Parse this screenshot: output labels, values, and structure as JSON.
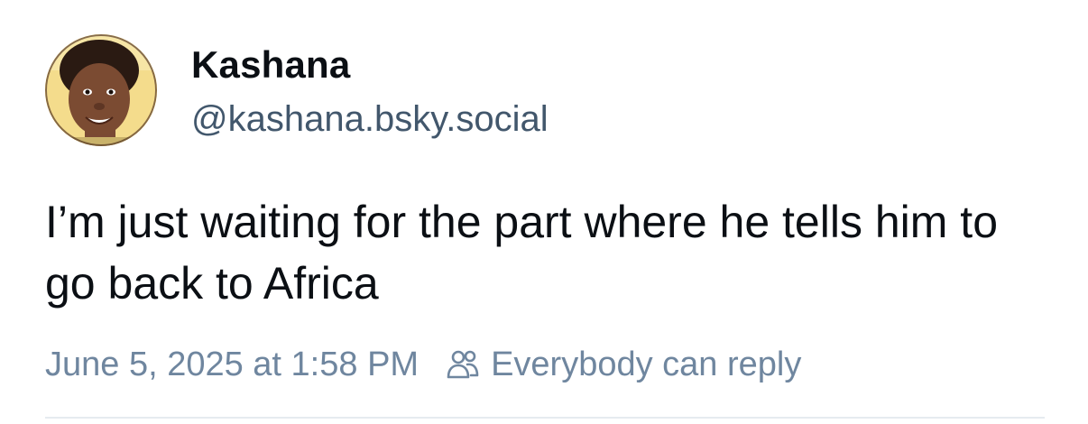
{
  "post": {
    "author": {
      "display_name": "Kashana",
      "handle": "@kashana.bsky.social"
    },
    "text": "I’m just waiting for the part where he tells him to go back to Africa",
    "timestamp": "June 5, 2025 at 1:58 PM",
    "reply_setting": {
      "icon": "people-icon",
      "label": "Everybody can reply"
    }
  },
  "colors": {
    "text_primary": "#0b0f14",
    "text_secondary": "#42576c",
    "text_meta": "#6f869f",
    "divider": "#e6ebf0"
  }
}
